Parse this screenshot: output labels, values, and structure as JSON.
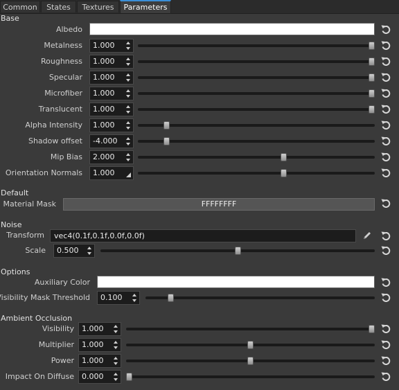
{
  "tabs": [
    "Common",
    "States",
    "Textures",
    "Parameters"
  ],
  "active_tab": "Parameters",
  "sections": {
    "base": "Base",
    "default": "Default",
    "noise": "Noise",
    "options": "Options",
    "ao": "Ambient Occlusion"
  },
  "base": {
    "albedo_label": "Albedo",
    "albedo_color": "#ffffff",
    "rows": [
      {
        "label": "Metalness",
        "value": "1.000",
        "level": 1.0
      },
      {
        "label": "Roughness",
        "value": "1.000",
        "level": 1.0
      },
      {
        "label": "Specular",
        "value": "1.000",
        "level": 1.0
      },
      {
        "label": "Microfiber",
        "value": "1.000",
        "level": 1.0
      },
      {
        "label": "Translucent",
        "value": "1.000",
        "level": 1.0
      },
      {
        "label": "Alpha Intensity",
        "value": "1.000",
        "level": 0.11
      },
      {
        "label": "Shadow offset",
        "value": "-4.000",
        "level": 0.11
      },
      {
        "label": "Mip Bias",
        "value": "2.000",
        "level": 0.62
      },
      {
        "label": "Orientation Normals",
        "value": "1.000",
        "level": 0.62
      }
    ]
  },
  "default": {
    "mask_label": "Material Mask",
    "mask_value": "FFFFFFFF"
  },
  "noise": {
    "transform_label": "Transform",
    "transform_value": "vec4(0.1f,0.1f,0.0f,0.0f)",
    "scale_label": "Scale",
    "scale_value": "0.500",
    "scale_level": 0.5
  },
  "options": {
    "aux_label": "Auxiliary Color",
    "aux_color": "#ffffff",
    "threshold_label": "Visibility Mask Threshold",
    "threshold_value": "0.100",
    "threshold_level": 0.1
  },
  "ao": {
    "rows": [
      {
        "label": "Visibility",
        "value": "1.000",
        "level": 1.0
      },
      {
        "label": "Multiplier",
        "value": "1.000",
        "level": 0.5
      },
      {
        "label": "Power",
        "value": "1.000",
        "level": 0.5
      },
      {
        "label": "Impact On Diffuse",
        "value": "0.000",
        "level": 0.0
      }
    ]
  },
  "icons": {
    "reset": "reset-undo-icon",
    "edit": "pencil-icon",
    "spin": "spin-arrows-icon",
    "resize": "resize-corner-icon"
  }
}
